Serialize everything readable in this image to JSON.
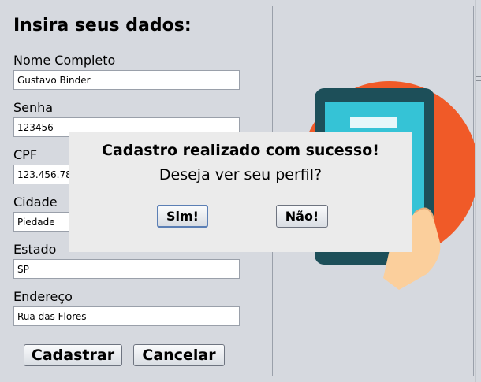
{
  "form": {
    "title": "Insira seus dados:",
    "fields": [
      {
        "label": "Nome Completo",
        "value": "Gustavo Binder"
      },
      {
        "label": "Senha",
        "value": "123456"
      },
      {
        "label": "CPF",
        "value": "123.456.789"
      },
      {
        "label": "Cidade",
        "value": "Piedade"
      },
      {
        "label": "Estado",
        "value": "SP"
      },
      {
        "label": "Endereço",
        "value": "Rua das Flores"
      }
    ],
    "register_label": "Cadastrar",
    "cancel_label": "Cancelar"
  },
  "illustration": {
    "icon": "phone-in-hand-icon",
    "colors": {
      "circle": "#f05a28",
      "phone_body": "#1d4f59",
      "screen": "#35c3d6",
      "hand": "#fbcf9c"
    }
  },
  "dialog": {
    "title": "Cadastro realizado com sucesso!",
    "message": "Deseja ver seu perfil?",
    "yes_label": "Sim!",
    "no_label": "Não!"
  }
}
